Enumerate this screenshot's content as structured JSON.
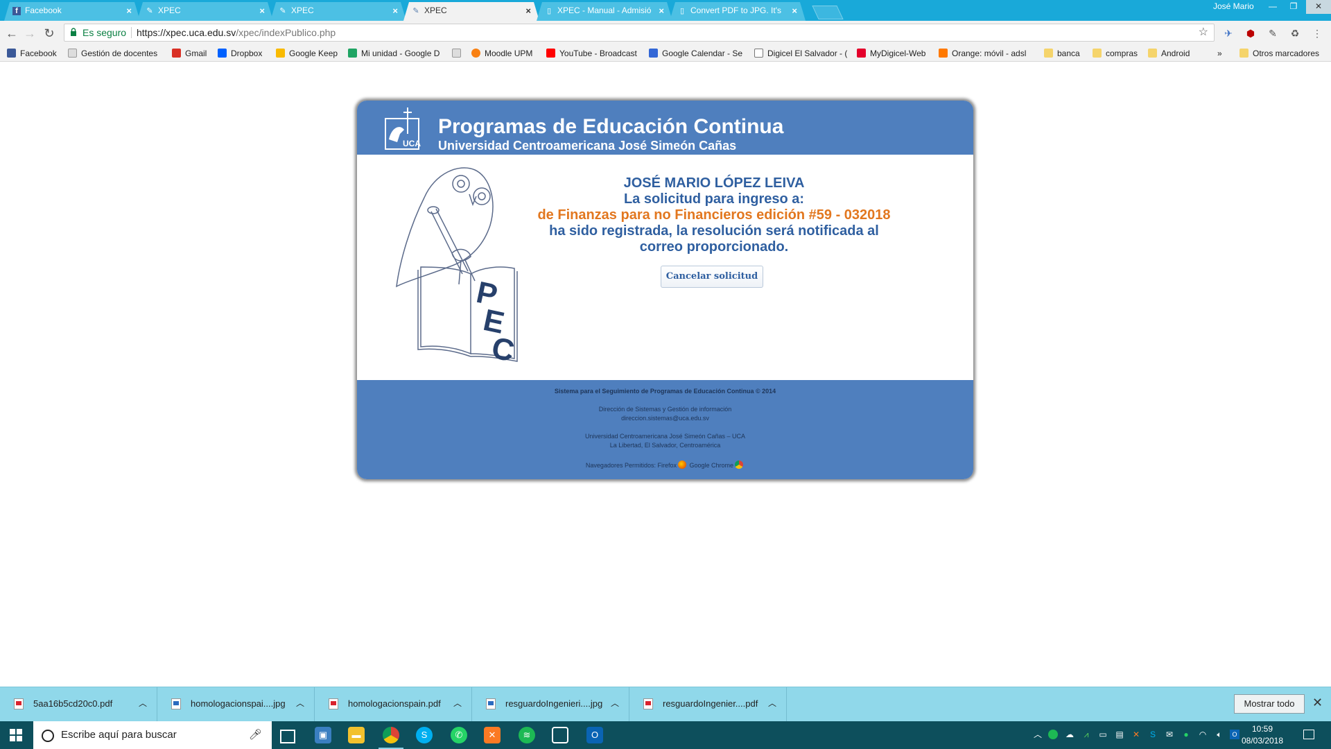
{
  "browser": {
    "tabs": [
      {
        "title": "Facebook",
        "icon": "facebook-icon",
        "active": false
      },
      {
        "title": "XPEC",
        "icon": "uca-icon",
        "active": false
      },
      {
        "title": "XPEC",
        "icon": "uca-icon",
        "active": false
      },
      {
        "title": "XPEC",
        "icon": "uca-icon",
        "active": true
      },
      {
        "title": "XPEC - Manual - Admisió",
        "icon": "doc-icon",
        "active": false
      },
      {
        "title": "Convert PDF to JPG. It's",
        "icon": "doc-icon",
        "active": false
      }
    ],
    "user": "José Mario",
    "security_label": "Es seguro",
    "url_host": "https://xpec.uca.edu.sv",
    "url_path": "/xpec/indexPublico.php"
  },
  "bookmarks": [
    {
      "label": "Facebook",
      "color": "#3b5998"
    },
    {
      "label": "Gestión de docentes",
      "color": "#c9c9c9"
    },
    {
      "label": "Gmail",
      "color": "#d93025"
    },
    {
      "label": "Dropbox",
      "color": "#0061fe"
    },
    {
      "label": "Google Keep",
      "color": "#f9ba00"
    },
    {
      "label": "Mi unidad - Google D",
      "color": "#1fa463"
    },
    {
      "label": "",
      "color": "#c9c9c9"
    },
    {
      "label": "Moodle UPM",
      "color": "#f98012"
    },
    {
      "label": "YouTube - Broadcast",
      "color": "#ff0000"
    },
    {
      "label": "Google Calendar - Se",
      "color": "#3367d6"
    },
    {
      "label": "Digicel El Salvador - (",
      "color": "#ffffff"
    },
    {
      "label": "MyDigicel-Web",
      "color": "#e4002b"
    },
    {
      "label": "Orange: móvil - adsl",
      "color": "#ff7900"
    },
    {
      "label": "banca",
      "color": "#f5d46b"
    },
    {
      "label": "compras",
      "color": "#f5d46b"
    },
    {
      "label": "Android",
      "color": "#f5d46b"
    },
    {
      "label": "»",
      "color": ""
    },
    {
      "label": "Otros marcadores",
      "color": "#f5d46b"
    }
  ],
  "page": {
    "header_title": "Programas de Educación Continua",
    "header_subtitle": "Universidad Centroamericana José Simeón Cañas",
    "message": {
      "name": "JOSÉ MARIO LÓPEZ LEIVA",
      "line1": "La solicitud para ingreso a:",
      "program": "de Finanzas para no Financieros edición #59 - 032018",
      "line2": "ha sido registrada, la resolución será notificada al",
      "line3": "correo proporcionado."
    },
    "cancel_label": "Cancelar solicitud",
    "footer": {
      "title": "Sistema para el Seguimiento de Programas de Educación Continua © 2014",
      "dept": "Dirección de Sistemas y Gestión de información",
      "email": "direccion.sistemas@uca.edu.sv",
      "university": "Universidad Centroamericana José Simeón Cañas – UCA",
      "address": "La Libertad, El Salvador, Centroamérica",
      "browsers_label": "Navegadores Permitidos:",
      "firefox": "Firefox",
      "chrome": "Google Chrome"
    }
  },
  "downloads": [
    {
      "name": "5aa16b5cd20c0.pdf",
      "type": "pdf"
    },
    {
      "name": "homologacionspai....jpg",
      "type": "jpg"
    },
    {
      "name": "homologacionspain.pdf",
      "type": "pdf"
    },
    {
      "name": "resguardoIngenieri....jpg",
      "type": "jpg"
    },
    {
      "name": "resguardoIngenier....pdf",
      "type": "pdf"
    }
  ],
  "downloads_show_all": "Mostrar todo",
  "taskbar": {
    "search_placeholder": "Escribe aquí para buscar",
    "time": "10:59",
    "date": "08/03/2018"
  }
}
